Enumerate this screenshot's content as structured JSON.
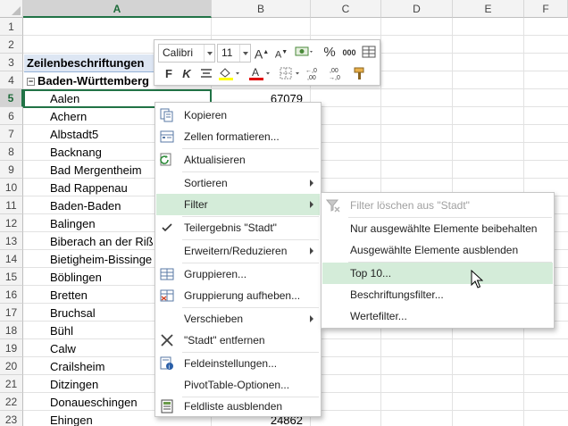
{
  "sheet": {
    "columns": [
      "A",
      "B",
      "C",
      "D",
      "E",
      "F"
    ],
    "rows": [
      "1",
      "2",
      "3",
      "4",
      "5",
      "6",
      "7",
      "8",
      "9",
      "10",
      "11",
      "12",
      "13",
      "14",
      "15",
      "16",
      "17",
      "18",
      "19",
      "20",
      "21",
      "22",
      "23"
    ],
    "header_label": "Zeilenbeschriftungen",
    "group_label": "Baden-Württemberg",
    "collapse_glyph": "−",
    "cities": [
      "Aalen",
      "Achern",
      "Albstadt5",
      "Backnang",
      "Bad Mergentheim",
      "Bad Rappenau",
      "Baden-Baden",
      "Balingen",
      "Biberach an der Riß",
      "Bietigheim-Bissinge",
      "Böblingen",
      "Bretten",
      "Bruchsal",
      "Bühl",
      "Calw",
      "Crailsheim",
      "Ditzingen",
      "Donaueschingen",
      "Ehingen"
    ],
    "values": {
      "aalen": "67079",
      "ehingen": "24862"
    }
  },
  "mini_toolbar": {
    "font_name": "Calibri",
    "font_size": "11",
    "bold": "F",
    "italic": "K",
    "percent": "%",
    "thousands": "000",
    "grow_font": "A",
    "shrink_font": "A"
  },
  "context_menu": {
    "items": [
      {
        "label": "Kopieren",
        "icon": "copy-icon"
      },
      {
        "label": "Zellen formatieren...",
        "icon": "format-cells-icon"
      },
      {
        "label": "Aktualisieren",
        "icon": "refresh-icon"
      },
      {
        "label": "Sortieren",
        "icon": "",
        "submenu": true
      },
      {
        "label": "Filter",
        "icon": "",
        "submenu": true,
        "highlighted": true
      },
      {
        "label": "Teilergebnis \"Stadt\"",
        "icon": "checkmark-icon"
      },
      {
        "label": "Erweitern/Reduzieren",
        "icon": "",
        "submenu": true
      },
      {
        "label": "Gruppieren...",
        "icon": "group-icon"
      },
      {
        "label": "Gruppierung aufheben...",
        "icon": "ungroup-icon"
      },
      {
        "label": "Verschieben",
        "icon": "",
        "submenu": true
      },
      {
        "label": "\"Stadt\" entfernen",
        "icon": "remove-x-icon"
      },
      {
        "label": "Feldeinstellungen...",
        "icon": "field-settings-icon"
      },
      {
        "label": "PivotTable-Optionen...",
        "icon": ""
      },
      {
        "label": "Feldliste ausblenden",
        "icon": "field-list-icon"
      }
    ]
  },
  "filter_submenu": {
    "items": [
      {
        "label": "Filter löschen aus \"Stadt\"",
        "disabled": true,
        "icon": "clear-filter-icon"
      },
      {
        "label": "Nur ausgewählte Elemente beibehalten"
      },
      {
        "label": "Ausgewählte Elemente ausblenden"
      },
      {
        "label": "Top 10...",
        "highlighted": true
      },
      {
        "label": "Beschriftungsfilter..."
      },
      {
        "label": "Wertefilter..."
      }
    ]
  },
  "colors": {
    "accent_green": "#217346",
    "menu_highlight": "#d4ecd9",
    "pivot_header_band": "#dde6f3"
  }
}
